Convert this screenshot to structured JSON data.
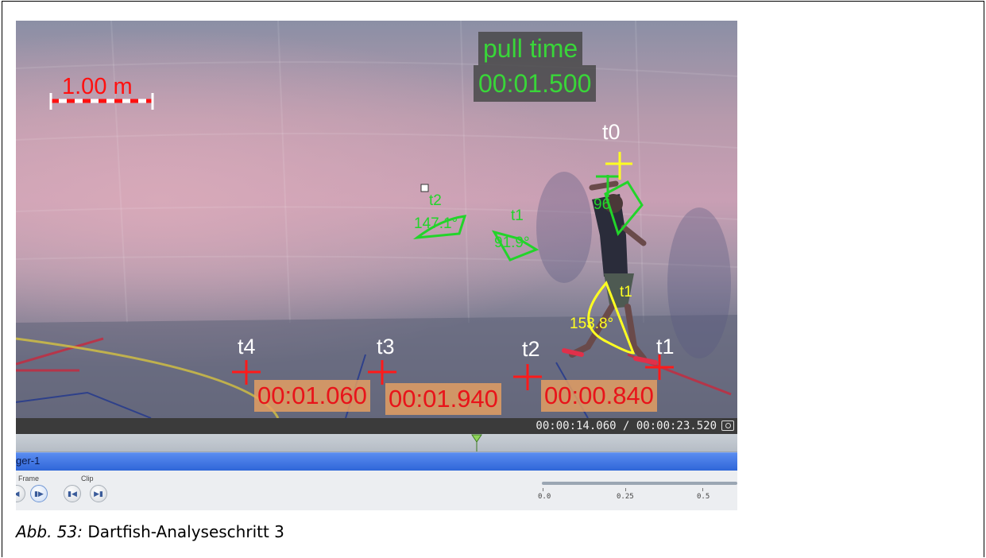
{
  "video": {
    "scale_label": "1.00 m",
    "pull_time_title": "pull time",
    "pull_time_value": "00:01.500",
    "markers": [
      {
        "label": "t0",
        "color": "#ffff22"
      },
      {
        "label": "t1",
        "color": "#ff1a1a"
      },
      {
        "label": "t2",
        "color": "#ff1a1a"
      },
      {
        "label": "t3",
        "color": "#ff1a1a"
      },
      {
        "label": "t4",
        "color": "#ff1a1a"
      }
    ],
    "intervals": [
      "00:01.060",
      "00:01.940",
      "00:00.840"
    ],
    "angles": {
      "green_t2_label": "t2",
      "green_t2_value": "147.1°",
      "green_t1_label": "t1",
      "green_t1_value": "91.9°",
      "green_t0_value": "96",
      "yellow_t1_label": "t1",
      "yellow_t1_value": "153.8°"
    }
  },
  "player": {
    "timecode": "00:00:14.060 / 00:00:23.520",
    "clip_track_label": "ger-1",
    "frame_label": "Frame",
    "clip_label": "Clip",
    "zoom_ticks": [
      "0.0",
      "0.25",
      "0.5"
    ]
  },
  "caption": {
    "prefix": "Abb. 53:",
    "text": " Dartfish-Analyseschritt 3"
  },
  "colors": {
    "overlay_green": "#39d639",
    "overlay_red": "#ff1a1a",
    "overlay_yellow": "#ffff22",
    "clip_blue": "#2f66d8"
  }
}
